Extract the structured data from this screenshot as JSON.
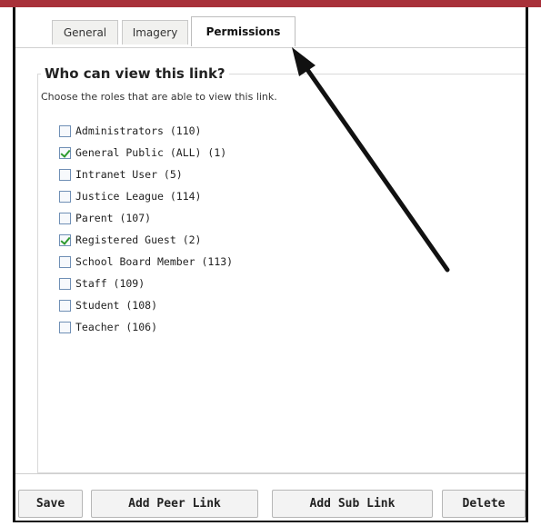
{
  "tabs": [
    {
      "label": "General",
      "active": false
    },
    {
      "label": "Imagery",
      "active": false
    },
    {
      "label": "Permissions",
      "active": true
    }
  ],
  "permissions": {
    "heading": "Who can view this link?",
    "instruction": "Choose the roles that are able to view this link.",
    "roles": [
      {
        "label": "Administrators (110)",
        "checked": false
      },
      {
        "label": "General Public (ALL) (1)",
        "checked": true
      },
      {
        "label": "Intranet User (5)",
        "checked": false
      },
      {
        "label": "Justice League (114)",
        "checked": false
      },
      {
        "label": "Parent (107)",
        "checked": false
      },
      {
        "label": "Registered Guest (2)",
        "checked": true
      },
      {
        "label": "School Board Member (113)",
        "checked": false
      },
      {
        "label": "Staff (109)",
        "checked": false
      },
      {
        "label": "Student (108)",
        "checked": false
      },
      {
        "label": "Teacher (106)",
        "checked": false
      }
    ]
  },
  "buttons": {
    "save": "Save",
    "add_peer": "Add Peer Link",
    "add_sub": "Add Sub Link",
    "delete": "Delete"
  },
  "colors": {
    "top_bar": "#a8313a",
    "checkmark": "#2e9a2e",
    "arrow": "#111111"
  }
}
